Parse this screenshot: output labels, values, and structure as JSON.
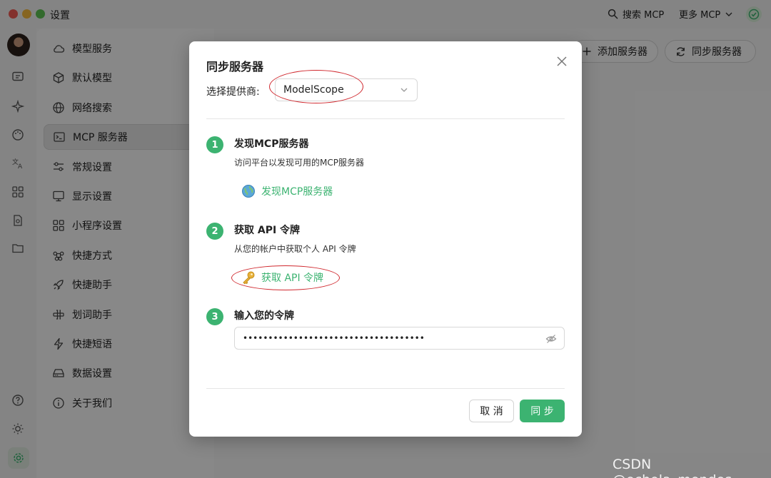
{
  "window": {
    "title": "设置"
  },
  "titlebar": {
    "search_label": "搜索 MCP",
    "more_label": "更多 MCP"
  },
  "sidebar": {
    "items": [
      {
        "label": "模型服务",
        "icon": "cloud-icon"
      },
      {
        "label": "默认模型",
        "icon": "cube-icon"
      },
      {
        "label": "网络搜索",
        "icon": "globe-icon"
      },
      {
        "label": "MCP 服务器",
        "icon": "terminal-icon",
        "active": true
      },
      {
        "label": "常规设置",
        "icon": "sliders-icon"
      },
      {
        "label": "显示设置",
        "icon": "monitor-icon"
      },
      {
        "label": "小程序设置",
        "icon": "grid-icon"
      },
      {
        "label": "快捷方式",
        "icon": "command-icon"
      },
      {
        "label": "快捷助手",
        "icon": "rocket-icon"
      },
      {
        "label": "划词助手",
        "icon": "text-select-icon"
      },
      {
        "label": "快捷短语",
        "icon": "zap-icon"
      },
      {
        "label": "数据设置",
        "icon": "hard-drive-icon"
      },
      {
        "label": "关于我们",
        "icon": "info-icon"
      }
    ]
  },
  "main": {
    "add_server_label": "添加服务器",
    "sync_servers_label": "同步服务器"
  },
  "modal": {
    "title": "同步服务器",
    "provider_label": "选择提供商:",
    "provider_value": "ModelScope",
    "steps": [
      {
        "number": "1",
        "title": "发现MCP服务器",
        "description": "访问平台以发现可用的MCP服务器",
        "link_label": "发现MCP服务器",
        "link_icon": "globe-icon"
      },
      {
        "number": "2",
        "title": "获取 API 令牌",
        "description": "从您的帐户中获取个人 API 令牌",
        "link_label": "获取 API 令牌",
        "link_icon": "key-icon"
      },
      {
        "number": "3",
        "title": "输入您的令牌"
      }
    ],
    "token_value": "••••••••••••••••••••••••••••••••••••",
    "cancel_label": "取 消",
    "confirm_label": "同 步"
  },
  "colors": {
    "accent": "#3cb371",
    "annotation_ring": "#d0282e"
  },
  "watermark": "CSDN @echola_mendes"
}
